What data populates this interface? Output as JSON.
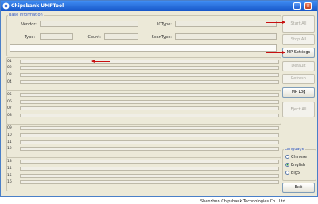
{
  "window": {
    "title": "Chipsbank UMPTool"
  },
  "base_info": {
    "group_label": "Base Information",
    "vendor_label": "Vendor:",
    "ictype_label": "ICType:",
    "type_label": "Type:",
    "count_label": "Count:",
    "scantype_label": "ScanType:"
  },
  "ports": [
    "01",
    "02",
    "03",
    "04",
    "05",
    "06",
    "07",
    "08",
    "09",
    "10",
    "11",
    "12",
    "13",
    "14",
    "15",
    "16"
  ],
  "buttons": {
    "start_all": "Start All",
    "stop_all": "Stop All",
    "mp_settings": "MP Settings",
    "default": "Default",
    "refresh": "Refresh",
    "mp_log": "MP Log",
    "eject_all": "Eject All",
    "exit": "Exit"
  },
  "language": {
    "group_label": "Language",
    "options": [
      "Chinese",
      "English",
      "Big5"
    ],
    "selected": "English"
  },
  "footer": {
    "company": "Shenzhen Chipsbank Technologies Co., Ltd."
  },
  "colors": {
    "title_bar": "#2a6ee0",
    "annotation_arrow": "#c81010",
    "group_label": "#3a5fc2"
  }
}
